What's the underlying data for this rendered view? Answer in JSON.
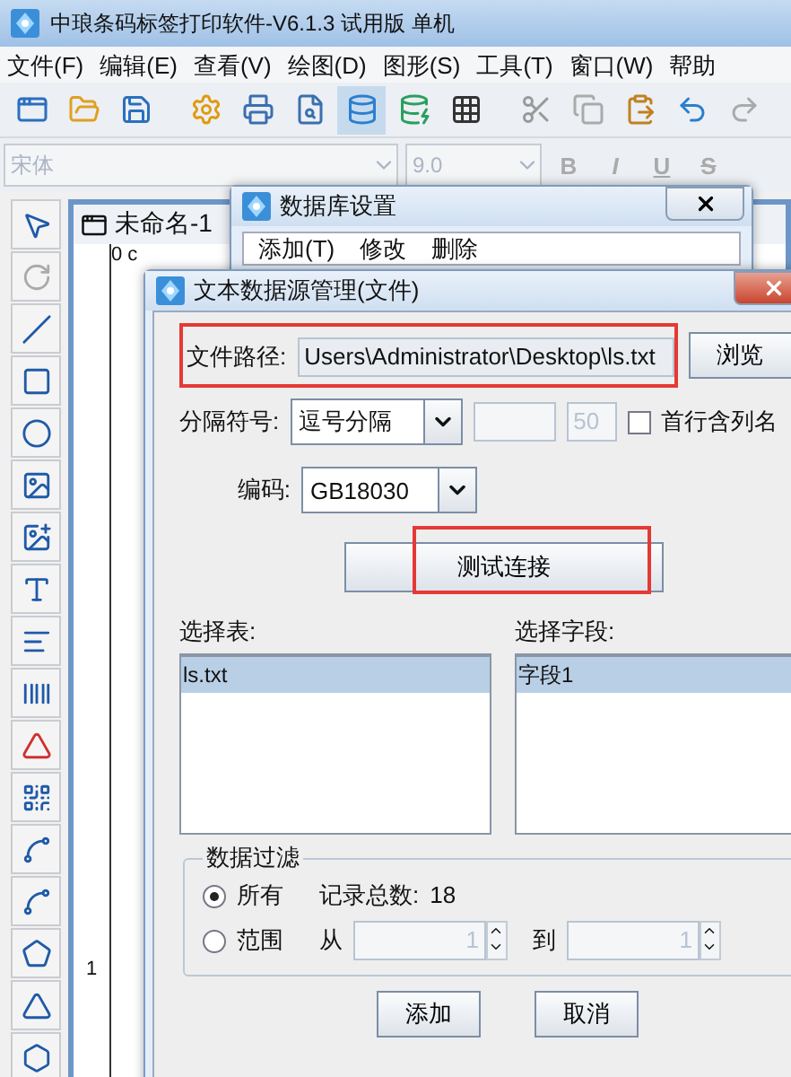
{
  "app_window": {
    "title": "中琅条码标签打印软件-V6.1.3 试用版 单机"
  },
  "menu": [
    "文件(F)",
    "编辑(E)",
    "查看(V)",
    "绘图(D)",
    "图形(S)",
    "工具(T)",
    "窗口(W)",
    "帮助"
  ],
  "toolbar": [
    {
      "kind": "window",
      "selected": false
    },
    {
      "kind": "open",
      "selected": false
    },
    {
      "kind": "save",
      "selected": false
    },
    {
      "kind": "gap"
    },
    {
      "kind": "settings",
      "selected": false
    },
    {
      "kind": "print",
      "selected": false
    },
    {
      "kind": "preview",
      "selected": false
    },
    {
      "kind": "database",
      "selected": true
    },
    {
      "kind": "database-link",
      "selected": false
    },
    {
      "kind": "grid",
      "selected": false
    },
    {
      "kind": "gap"
    },
    {
      "kind": "cut",
      "selected": false
    },
    {
      "kind": "copy",
      "selected": false
    },
    {
      "kind": "paste",
      "selected": false
    },
    {
      "kind": "undo",
      "selected": false
    },
    {
      "kind": "redo",
      "selected": false
    }
  ],
  "format_bar": {
    "font": "宋体",
    "size": "9.0",
    "styles": [
      "B",
      "I",
      "U",
      "S"
    ]
  },
  "left_tools": [
    {
      "kind": "pointer"
    },
    {
      "kind": "rotate"
    },
    {
      "kind": "line"
    },
    {
      "kind": "rectangle"
    },
    {
      "kind": "ellipse"
    },
    {
      "kind": "image"
    },
    {
      "kind": "image-color"
    },
    {
      "kind": "text"
    },
    {
      "kind": "paragraph"
    },
    {
      "kind": "barcode"
    },
    {
      "kind": "triangle-badge"
    },
    {
      "kind": "qrcode"
    },
    {
      "kind": "curve"
    },
    {
      "kind": "arc"
    },
    {
      "kind": "polygon"
    },
    {
      "kind": "triangle"
    },
    {
      "kind": "hexagon"
    }
  ],
  "document": {
    "tab": "未命名-1",
    "ruler_top": "0 c",
    "ruler_side": "1"
  },
  "db_dialog": {
    "title": "数据库设置",
    "menu": [
      "添加(T)",
      "修改",
      "删除"
    ]
  },
  "text_source_dialog": {
    "title": "文本数据源管理(文件)",
    "path": {
      "label": "文件路径:",
      "value": "Users\\Administrator\\Desktop\\ls.txt",
      "highlighted": true,
      "button": "浏览"
    },
    "separator": {
      "label": "分隔符号:",
      "value": "逗号分隔",
      "width_value": "50",
      "header_label": "首行含列名",
      "header_checked": false
    },
    "encoding": {
      "label": "编码:",
      "value": "GB18030"
    },
    "test_button": {
      "label": "测试连接",
      "highlighted": true
    },
    "tables": {
      "label": "选择表:",
      "items": [
        {
          "text": "ls.txt",
          "selected": true
        }
      ]
    },
    "fields": {
      "label": "选择字段:",
      "items": [
        {
          "text": "字段1",
          "selected": true
        }
      ]
    },
    "filter": {
      "title": "数据过滤",
      "options": [
        {
          "label": "所有",
          "selected": true
        },
        {
          "label": "范围",
          "selected": false
        }
      ],
      "count_label": "记录总数:",
      "count": "18",
      "from_label": "从",
      "from": "1",
      "to_label": "到",
      "to": "1"
    },
    "buttons": [
      "添加",
      "取消"
    ]
  }
}
